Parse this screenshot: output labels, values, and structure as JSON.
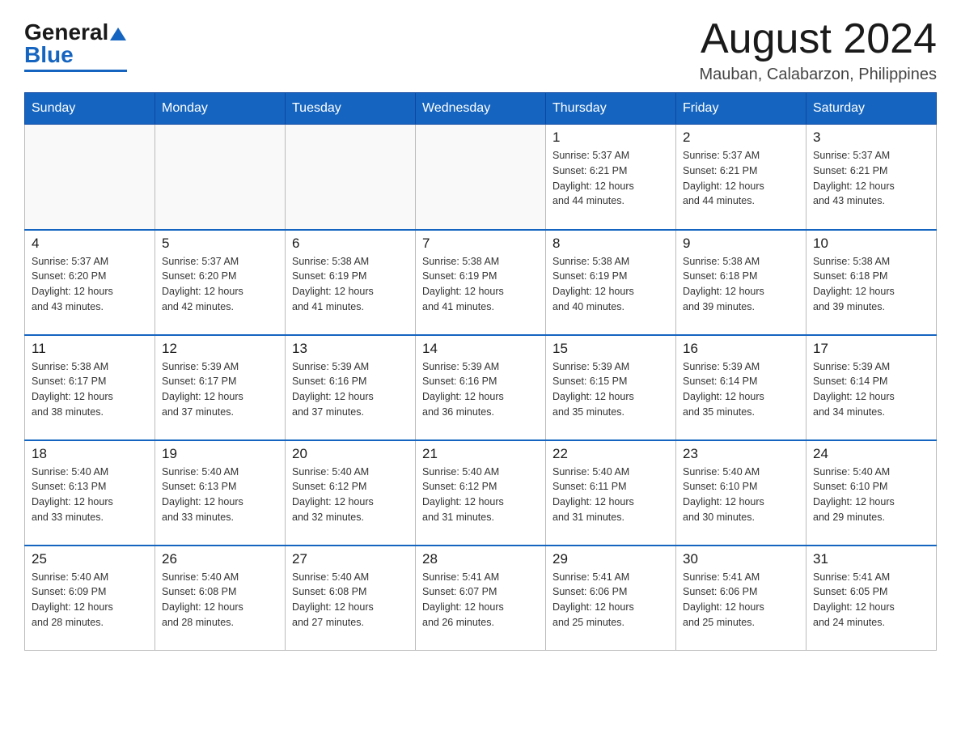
{
  "header": {
    "logo_general": "General",
    "logo_blue": "Blue",
    "month_title": "August 2024",
    "location": "Mauban, Calabarzon, Philippines"
  },
  "days_of_week": [
    "Sunday",
    "Monday",
    "Tuesday",
    "Wednesday",
    "Thursday",
    "Friday",
    "Saturday"
  ],
  "weeks": [
    [
      {
        "day": "",
        "info": ""
      },
      {
        "day": "",
        "info": ""
      },
      {
        "day": "",
        "info": ""
      },
      {
        "day": "",
        "info": ""
      },
      {
        "day": "1",
        "info": "Sunrise: 5:37 AM\nSunset: 6:21 PM\nDaylight: 12 hours\nand 44 minutes."
      },
      {
        "day": "2",
        "info": "Sunrise: 5:37 AM\nSunset: 6:21 PM\nDaylight: 12 hours\nand 44 minutes."
      },
      {
        "day": "3",
        "info": "Sunrise: 5:37 AM\nSunset: 6:21 PM\nDaylight: 12 hours\nand 43 minutes."
      }
    ],
    [
      {
        "day": "4",
        "info": "Sunrise: 5:37 AM\nSunset: 6:20 PM\nDaylight: 12 hours\nand 43 minutes."
      },
      {
        "day": "5",
        "info": "Sunrise: 5:37 AM\nSunset: 6:20 PM\nDaylight: 12 hours\nand 42 minutes."
      },
      {
        "day": "6",
        "info": "Sunrise: 5:38 AM\nSunset: 6:19 PM\nDaylight: 12 hours\nand 41 minutes."
      },
      {
        "day": "7",
        "info": "Sunrise: 5:38 AM\nSunset: 6:19 PM\nDaylight: 12 hours\nand 41 minutes."
      },
      {
        "day": "8",
        "info": "Sunrise: 5:38 AM\nSunset: 6:19 PM\nDaylight: 12 hours\nand 40 minutes."
      },
      {
        "day": "9",
        "info": "Sunrise: 5:38 AM\nSunset: 6:18 PM\nDaylight: 12 hours\nand 39 minutes."
      },
      {
        "day": "10",
        "info": "Sunrise: 5:38 AM\nSunset: 6:18 PM\nDaylight: 12 hours\nand 39 minutes."
      }
    ],
    [
      {
        "day": "11",
        "info": "Sunrise: 5:38 AM\nSunset: 6:17 PM\nDaylight: 12 hours\nand 38 minutes."
      },
      {
        "day": "12",
        "info": "Sunrise: 5:39 AM\nSunset: 6:17 PM\nDaylight: 12 hours\nand 37 minutes."
      },
      {
        "day": "13",
        "info": "Sunrise: 5:39 AM\nSunset: 6:16 PM\nDaylight: 12 hours\nand 37 minutes."
      },
      {
        "day": "14",
        "info": "Sunrise: 5:39 AM\nSunset: 6:16 PM\nDaylight: 12 hours\nand 36 minutes."
      },
      {
        "day": "15",
        "info": "Sunrise: 5:39 AM\nSunset: 6:15 PM\nDaylight: 12 hours\nand 35 minutes."
      },
      {
        "day": "16",
        "info": "Sunrise: 5:39 AM\nSunset: 6:14 PM\nDaylight: 12 hours\nand 35 minutes."
      },
      {
        "day": "17",
        "info": "Sunrise: 5:39 AM\nSunset: 6:14 PM\nDaylight: 12 hours\nand 34 minutes."
      }
    ],
    [
      {
        "day": "18",
        "info": "Sunrise: 5:40 AM\nSunset: 6:13 PM\nDaylight: 12 hours\nand 33 minutes."
      },
      {
        "day": "19",
        "info": "Sunrise: 5:40 AM\nSunset: 6:13 PM\nDaylight: 12 hours\nand 33 minutes."
      },
      {
        "day": "20",
        "info": "Sunrise: 5:40 AM\nSunset: 6:12 PM\nDaylight: 12 hours\nand 32 minutes."
      },
      {
        "day": "21",
        "info": "Sunrise: 5:40 AM\nSunset: 6:12 PM\nDaylight: 12 hours\nand 31 minutes."
      },
      {
        "day": "22",
        "info": "Sunrise: 5:40 AM\nSunset: 6:11 PM\nDaylight: 12 hours\nand 31 minutes."
      },
      {
        "day": "23",
        "info": "Sunrise: 5:40 AM\nSunset: 6:10 PM\nDaylight: 12 hours\nand 30 minutes."
      },
      {
        "day": "24",
        "info": "Sunrise: 5:40 AM\nSunset: 6:10 PM\nDaylight: 12 hours\nand 29 minutes."
      }
    ],
    [
      {
        "day": "25",
        "info": "Sunrise: 5:40 AM\nSunset: 6:09 PM\nDaylight: 12 hours\nand 28 minutes."
      },
      {
        "day": "26",
        "info": "Sunrise: 5:40 AM\nSunset: 6:08 PM\nDaylight: 12 hours\nand 28 minutes."
      },
      {
        "day": "27",
        "info": "Sunrise: 5:40 AM\nSunset: 6:08 PM\nDaylight: 12 hours\nand 27 minutes."
      },
      {
        "day": "28",
        "info": "Sunrise: 5:41 AM\nSunset: 6:07 PM\nDaylight: 12 hours\nand 26 minutes."
      },
      {
        "day": "29",
        "info": "Sunrise: 5:41 AM\nSunset: 6:06 PM\nDaylight: 12 hours\nand 25 minutes."
      },
      {
        "day": "30",
        "info": "Sunrise: 5:41 AM\nSunset: 6:06 PM\nDaylight: 12 hours\nand 25 minutes."
      },
      {
        "day": "31",
        "info": "Sunrise: 5:41 AM\nSunset: 6:05 PM\nDaylight: 12 hours\nand 24 minutes."
      }
    ]
  ]
}
